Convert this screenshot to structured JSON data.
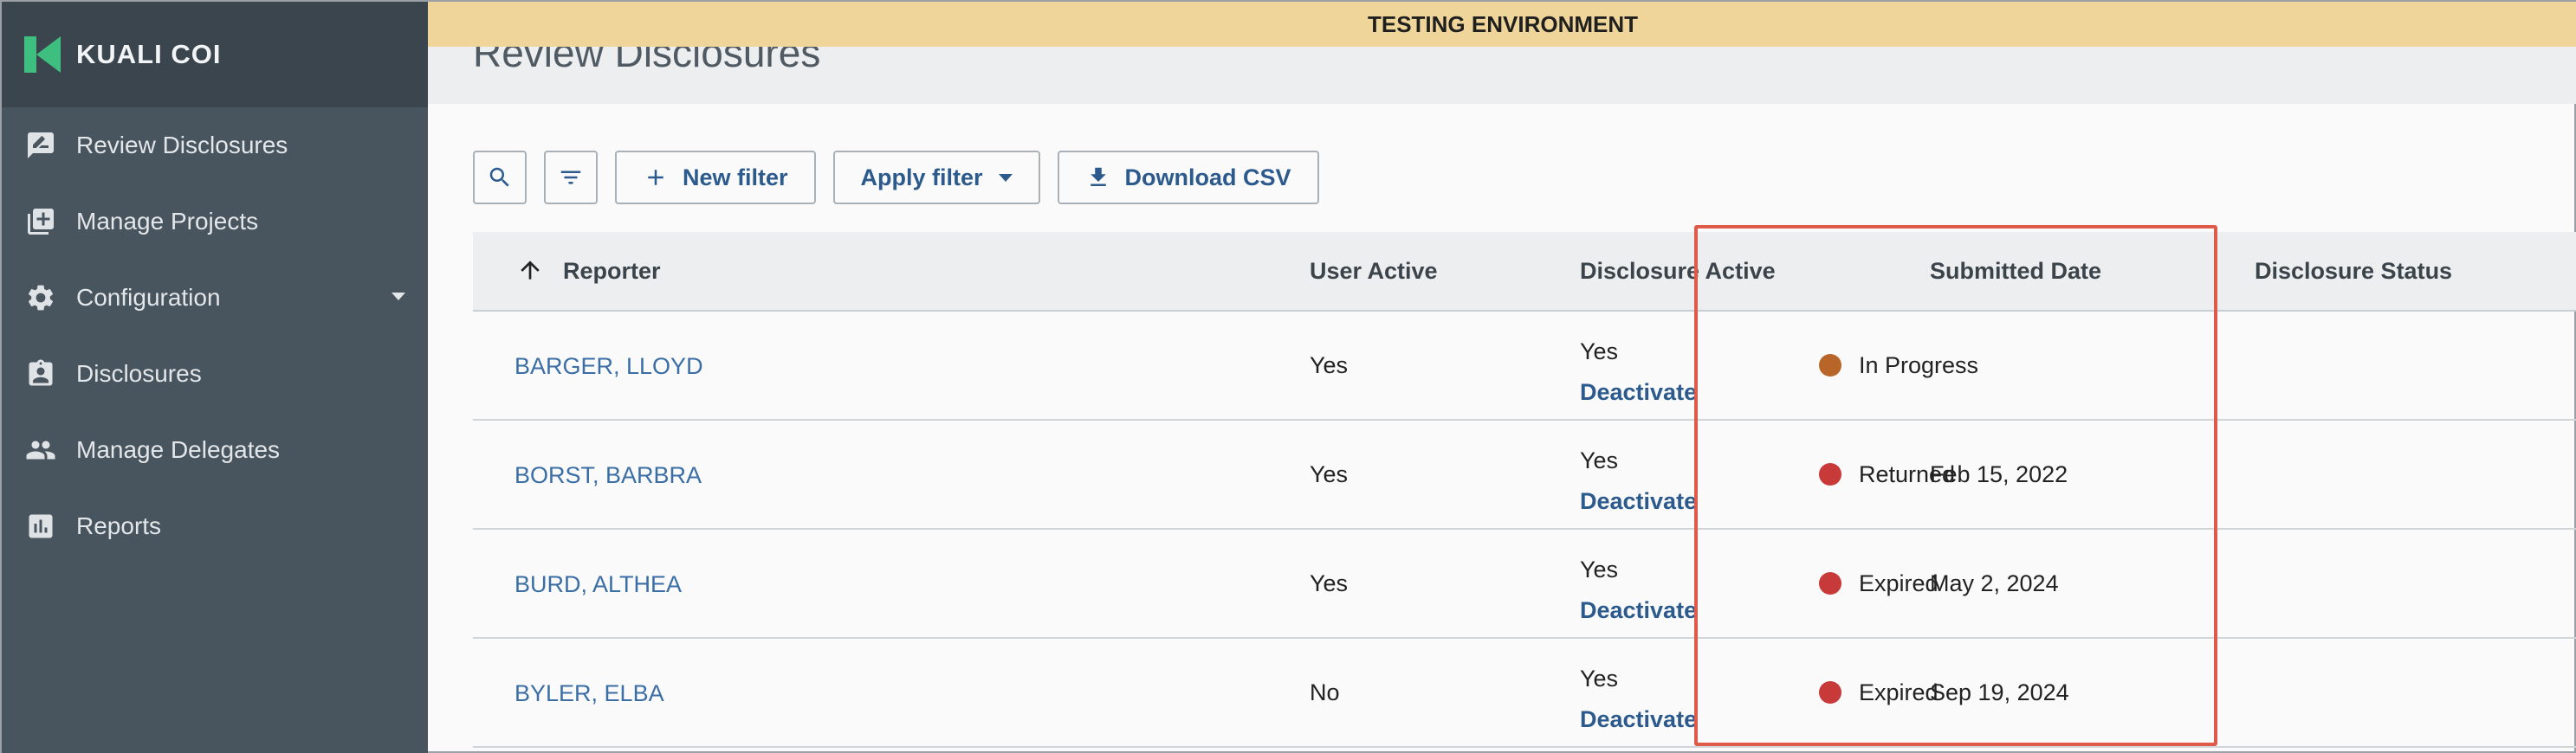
{
  "sidebar": {
    "brand": "KUALI COI",
    "items": [
      {
        "label": "Review Disclosures",
        "icon": "rate-review-icon"
      },
      {
        "label": "Manage Projects",
        "icon": "library-add-icon"
      },
      {
        "label": "Configuration",
        "icon": "gear-icon"
      },
      {
        "label": "Disclosures",
        "icon": "assignment-ind-icon"
      },
      {
        "label": "Manage Delegates",
        "icon": "people-icon"
      },
      {
        "label": "Reports",
        "icon": "bar-chart-icon"
      }
    ]
  },
  "banner": "TESTING ENVIRONMENT",
  "page": {
    "title": "Review Disclosures"
  },
  "toolbar": {
    "new_filter": "New filter",
    "apply_filter": "Apply filter",
    "download_csv": "Download CSV"
  },
  "table": {
    "headers": {
      "reporter": "Reporter",
      "user_active": "User Active",
      "disclosure_active": "Disclosure Active",
      "submitted_date": "Submitted Date",
      "disclosure_status": "Disclosure Status"
    },
    "rows": [
      {
        "reporter": "BARGER, LLOYD",
        "user_active": "Yes",
        "disclosure_active": "Yes",
        "action": "Deactivate",
        "submitted_date": "",
        "status": "In Progress",
        "status_color": "#b8652a"
      },
      {
        "reporter": "BORST, BARBRA",
        "user_active": "Yes",
        "disclosure_active": "Yes",
        "action": "Deactivate",
        "submitted_date": "Feb 15, 2022",
        "status": "Returned",
        "status_color": "#c83a3a"
      },
      {
        "reporter": "BURD, ALTHEA",
        "user_active": "Yes",
        "disclosure_active": "Yes",
        "action": "Deactivate",
        "submitted_date": "May 2, 2024",
        "status": "Expired",
        "status_color": "#c83a3a"
      },
      {
        "reporter": "BYLER, ELBA",
        "user_active": "No",
        "disclosure_active": "Yes",
        "action": "Deactivate",
        "submitted_date": "Sep 19, 2024",
        "status": "Expired",
        "status_color": "#c83a3a"
      }
    ]
  },
  "colors": {
    "accent": "#2c5a8d",
    "sidebar": "#48545e",
    "banner": "#f0d59a",
    "highlight": "#e05a4a"
  }
}
